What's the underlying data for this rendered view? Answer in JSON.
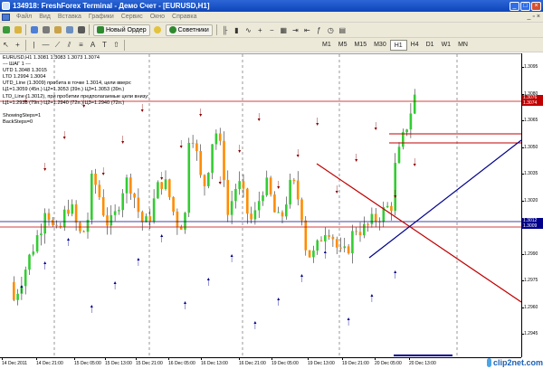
{
  "window": {
    "title": "134918: FreshForex Terminal - Демо Счет - [EURUSD,H1]"
  },
  "menu": {
    "items": [
      "Файл",
      "Вид",
      "Вставка",
      "Графики",
      "Сервис",
      "Окно",
      "Справка"
    ]
  },
  "toolbar": {
    "new_order": "Новый Ордер",
    "advisors": "Советники"
  },
  "timeframes": [
    "M1",
    "M5",
    "M15",
    "M30",
    "H1",
    "H4",
    "D1",
    "W1",
    "MN"
  ],
  "active_timeframe": "H1",
  "info": {
    "symbol_line": "EURUSD,H1  1.3081 1.3083 1.3073 1.3074",
    "lines": [
      "--- ШАГ 1 ---",
      "UTD  1.3048  1.3015",
      "LTD  1.2994  1.3004",
      "UTD_Line (1.3009) пробита в точке 1.3014, цели вверх:",
      "Ц1=1.3059 (45п.) Ц2=1.3053 (39п.) Ц3=1.3053 (39п.)",
      "LTD_Line (1.3012), при пробитии предполагаемые цели внизу:",
      "Ц1=1.2933 (79п.) Ц2=1.2940 (72п.) Ц3=1.2940 (72п.)",
      "",
      "ShowingSteps=1",
      "BackSteps=0"
    ]
  },
  "price_axis": {
    "labels": [
      "1.3095",
      "1.3080",
      "1.3065",
      "1.3050",
      "1.3035",
      "1.3020",
      "1.3005",
      "1.2990",
      "1.2975",
      "1.2960",
      "1.2945"
    ],
    "current_price": "1.3074",
    "current_price_top": "1.3076",
    "line_price": "1.3012",
    "line_price2": "1.3009"
  },
  "time_axis": {
    "labels": [
      "14 Dec 2011",
      "14 Dec 21:00",
      "15 Dec 05:00",
      "15 Dec 13:00",
      "15 Dec 21:00",
      "16 Dec 05:00",
      "16 Dec 13:00",
      "16 Dec 21:00",
      "19 Dec 05:00",
      "19 Dec 13:00",
      "19 Dec 21:00",
      "20 Dec 05:00",
      "20 Dec 13:00"
    ]
  },
  "watermark": "clip2net.com",
  "colors": {
    "bull": "#32cd32",
    "bear": "#ff8c00",
    "red_line": "#c00000",
    "blue_line": "#00008b",
    "price_label": "#c00000",
    "line_label": "#00008b"
  }
}
